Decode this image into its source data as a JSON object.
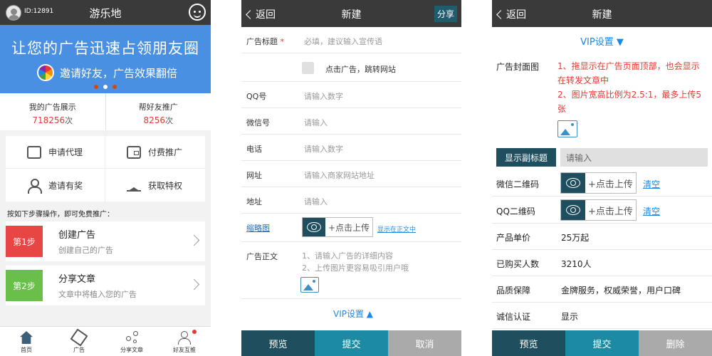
{
  "screen1": {
    "header": {
      "user_id": "ID:12891",
      "title": "游乐地"
    },
    "banner": {
      "headline": "让您的广告迅速占领朋友圈",
      "subline": "邀请好友，广告效果翻倍"
    },
    "stats": [
      {
        "label": "我的广告展示",
        "value": "718256",
        "unit": "次"
      },
      {
        "label": "帮好友推广",
        "value": "8256",
        "unit": "次"
      }
    ],
    "menu": [
      {
        "label": "申请代理",
        "icon": "agent-icon"
      },
      {
        "label": "付费推广",
        "icon": "wallet-icon"
      },
      {
        "label": "邀请有奖",
        "icon": "invite-icon"
      },
      {
        "label": "获取特权",
        "icon": "crown-icon"
      }
    ],
    "hint": "按如下步骤操作，即可免费推广：",
    "steps": [
      {
        "tag": "第1步",
        "title": "创建广告",
        "desc": "创建自己的广告",
        "color": "#e84545"
      },
      {
        "tag": "第2步",
        "title": "分享文章",
        "desc": "文章中将植入您的广告",
        "color": "#6abf4b"
      }
    ],
    "tabs": [
      {
        "label": "首页",
        "icon": "home-icon"
      },
      {
        "label": "广告",
        "icon": "pen-icon"
      },
      {
        "label": "分享文章",
        "icon": "share-icon"
      },
      {
        "label": "好友互推",
        "icon": "friends-icon"
      }
    ]
  },
  "screen2": {
    "nav": {
      "back": "返回",
      "title": "新建",
      "share": "分享"
    },
    "title_row": {
      "label": "广告标题",
      "required": "*",
      "placeholder": "必填，建议输入宣传语"
    },
    "checkbox_label": "点击广告，跳转网站",
    "fields": [
      {
        "label": "QQ号",
        "placeholder": "请输入数字"
      },
      {
        "label": "微信号",
        "placeholder": "请输入"
      },
      {
        "label": "电话",
        "placeholder": "请输入数字"
      },
      {
        "label": "网址",
        "placeholder": "请输入商家网站地址"
      },
      {
        "label": "地址",
        "placeholder": "请输入"
      }
    ],
    "thumb": {
      "label": "缩略图",
      "upload": "+点击上传",
      "show_in_body": "显示在正文中"
    },
    "body": {
      "label": "广告正文",
      "line1": "1、请输入广告的详细内容",
      "line2": "2、上传图片更容易吸引用户哦"
    },
    "vip": "VIP设置 ▲",
    "buttons": {
      "preview": "预览",
      "submit": "提交",
      "cancel": "取消"
    }
  },
  "screen3": {
    "nav": {
      "back": "返回",
      "title": "新建"
    },
    "vip": "VIP设置 ▼",
    "cover": {
      "label": "广告封面图",
      "line1": "1、拖显示在广告页面顶部，也会显示在转发文章中",
      "line2": "2、图片宽高比例为2.5:1，最多上传5张"
    },
    "subtitle": {
      "button": "显示副标题",
      "placeholder": "请输入"
    },
    "qr": [
      {
        "label": "微信二维码",
        "upload": "+点击上传",
        "clear": "清空"
      },
      {
        "label": "QQ二维码",
        "upload": "+点击上传",
        "clear": "清空"
      }
    ],
    "info": [
      {
        "label": "产品单价",
        "value": "25万起"
      },
      {
        "label": "已购买人数",
        "value": "3210人"
      },
      {
        "label": "品质保障",
        "value": "金牌服务，权威荣誉，用户口碑"
      },
      {
        "label": "诚信认证",
        "value": "显示"
      }
    ],
    "buttons": {
      "preview": "预览",
      "submit": "提交",
      "delete": "删除"
    }
  }
}
